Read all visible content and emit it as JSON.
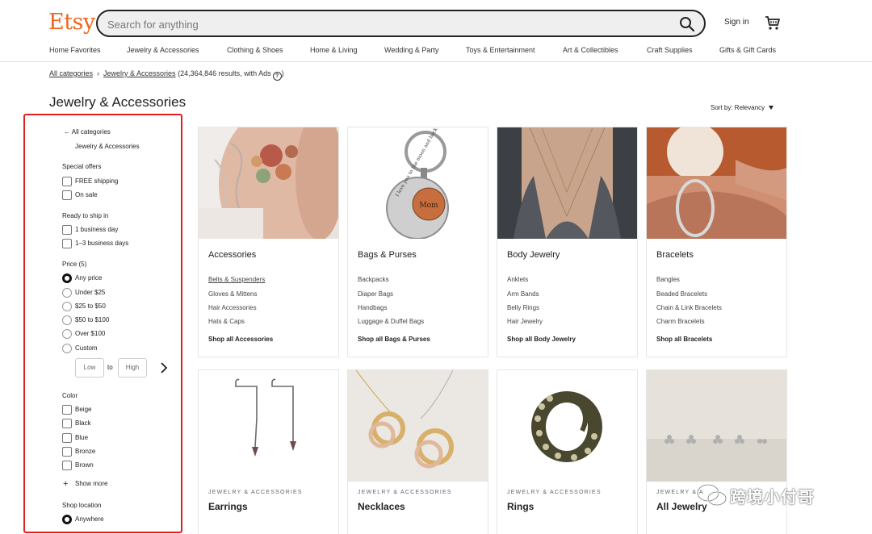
{
  "header": {
    "logo": "Etsy",
    "search_placeholder": "Search for anything",
    "signin_label": "Sign in"
  },
  "nav": {
    "items": [
      "Home Favorites",
      "Jewelry & Accessories",
      "Clothing & Shoes",
      "Home & Living",
      "Wedding & Party",
      "Toys & Entertainment",
      "Art & Collectibles",
      "Craft Supplies",
      "Gifts & Gift Cards"
    ]
  },
  "breadcrumb": {
    "root": "All categories",
    "current": "Jewelry & Accessories",
    "results": "(24,364,846 results, with Ads",
    "close": ")"
  },
  "page_title": "Jewelry & Accessories",
  "sort": {
    "label": "Sort by: Relevancy"
  },
  "sidebar": {
    "back": "All categories",
    "category": "Jewelry & Accessories",
    "special_offers": {
      "title": "Special offers",
      "options": [
        "FREE shipping",
        "On sale"
      ]
    },
    "ready_to_ship": {
      "title": "Ready to ship in",
      "options": [
        "1 business day",
        "1–3 business days"
      ]
    },
    "price": {
      "title": "Price (5)",
      "options": [
        "Any price",
        "Under $25",
        "$25 to $50",
        "$50 to $100",
        "Over $100",
        "Custom"
      ],
      "selected_index": 0,
      "low_placeholder": "Low",
      "to": "to",
      "high_placeholder": "High"
    },
    "color": {
      "title": "Color",
      "options": [
        "Beige",
        "Black",
        "Blue",
        "Bronze",
        "Brown"
      ],
      "show_more": "Show more"
    },
    "shop_location": {
      "title": "Shop location",
      "options": [
        "Anywhere"
      ]
    }
  },
  "cards": [
    {
      "title": "Accessories",
      "links": [
        "Belts & Suspenders",
        "Gloves & Mittens",
        "Hair Accessories",
        "Hats & Caps"
      ],
      "shop_all": "Shop all Accessories"
    },
    {
      "title": "Bags & Purses",
      "links": [
        "Backpacks",
        "Diaper Bags",
        "Handbags",
        "Luggage & Duffel Bags"
      ],
      "shop_all": "Shop all Bags & Purses"
    },
    {
      "title": "Body Jewelry",
      "links": [
        "Anklets",
        "Arm Bands",
        "Belly Rings",
        "Hair Jewelry"
      ],
      "shop_all": "Shop all Body Jewelry"
    },
    {
      "title": "Bracelets",
      "links": [
        "Bangles",
        "Beaded Bracelets",
        "Chain & Link Bracelets",
        "Charm Bracelets"
      ],
      "shop_all": "Shop all Bracelets"
    }
  ],
  "bottom_cards": [
    {
      "eyebrow": "JEWELRY & ACCESSORIES",
      "title": "Earrings"
    },
    {
      "eyebrow": "JEWELRY & ACCESSORIES",
      "title": "Necklaces"
    },
    {
      "eyebrow": "JEWELRY & ACCESSORIES",
      "title": "Rings"
    },
    {
      "eyebrow": "JEWELRY & A",
      "title": "All Jewelry"
    }
  ],
  "keychain_text": "I love you to the moon and back",
  "keychain_center": "Mom",
  "watermark": "跨境小付哥",
  "colors": {
    "brand": "#f1641e",
    "highlight": "#e02020"
  }
}
